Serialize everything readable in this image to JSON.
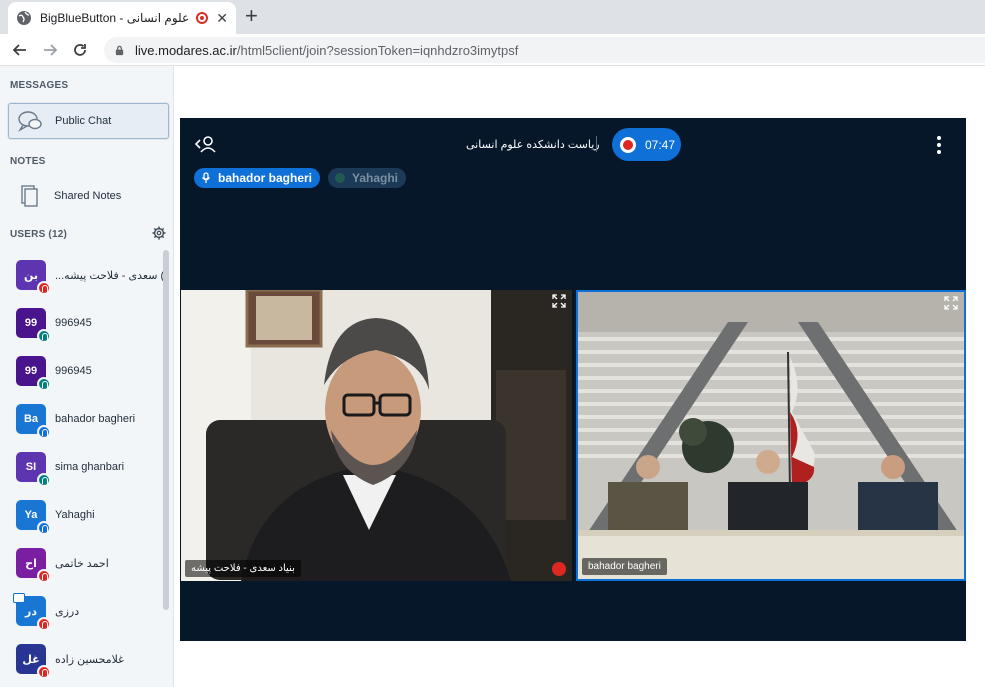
{
  "browser": {
    "tab_title": "BigBlueButton - علوم انسانی",
    "tab_close": "✕",
    "new_tab": "+",
    "url_domain": "live.modares.ac.ir",
    "url_path": "/html5client/join?sessionToken=iqnhdzro3imytpsf"
  },
  "sidebar": {
    "messages_heading": "MESSAGES",
    "public_chat": "Public Chat",
    "notes_heading": "NOTES",
    "shared_notes": "Shared Notes",
    "users_heading": "USERS (12)",
    "users": [
      {
        "initials": "بن",
        "name": "بنیاد سعدی - فلاحت پیشه",
        "display": "...سعدی - فلاحت پیشه (You)",
        "color": "#5e35b1",
        "status": "muted"
      },
      {
        "initials": "99",
        "name": "996945",
        "display": "996945",
        "color": "#4a148c",
        "status": "listen"
      },
      {
        "initials": "99",
        "name": "996945",
        "display": "996945",
        "color": "#4a148c",
        "status": "listen"
      },
      {
        "initials": "Ba",
        "name": "bahador bagheri",
        "display": "bahador bagheri",
        "color": "#1976d2",
        "status": "mic"
      },
      {
        "initials": "SI",
        "name": "sima ghanbari",
        "display": "sima ghanbari",
        "color": "#5e35b1",
        "status": "listen"
      },
      {
        "initials": "Ya",
        "name": "Yahaghi",
        "display": "Yahaghi",
        "color": "#1976d2",
        "status": "mic"
      },
      {
        "initials": "اح",
        "name": "احمد خاتمی",
        "display": "احمد خاتمی",
        "color": "#7b1fa2",
        "status": "muted"
      },
      {
        "initials": "در",
        "name": "درزی",
        "display": "درزی",
        "color": "#1976d2",
        "status": "muted"
      },
      {
        "initials": "غل",
        "name": "غلامحسین زاده",
        "display": "غلامحسین زاده",
        "color": "#283593",
        "status": "muted"
      }
    ]
  },
  "meeting": {
    "title": "ریاست دانشکده علوم انسانی",
    "recording_time": "07:47",
    "talkers": [
      {
        "name": "bahador bagheri",
        "active": true
      },
      {
        "name": "Yahaghi",
        "active": false
      }
    ],
    "videos": [
      {
        "label": "بنیاد سعدی - فلاحت پیشه"
      },
      {
        "label": "bahador bagheri"
      }
    ]
  },
  "colors": {
    "accent": "#0f70d7",
    "meeting_bg": "#06172a",
    "sidebar_bg": "#f3f6f9",
    "muted": "#df2721",
    "listen": "#008081"
  }
}
